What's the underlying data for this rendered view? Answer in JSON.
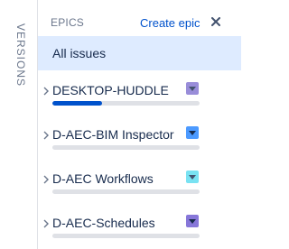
{
  "sidebar": {
    "versions_label": "VERSIONS"
  },
  "epics_panel": {
    "title": "EPICS",
    "create_label": "Create epic",
    "close_icon": "close-icon",
    "all_issues_label": "All issues",
    "items": [
      {
        "name": "DESKTOP-HUDDLE",
        "color": "#998dd9",
        "progress": 0.34
      },
      {
        "name": "D-AEC-BIM Inspector",
        "color": "#4c9aff",
        "progress": 0
      },
      {
        "name": "D-AEC Workflows",
        "color": "#79e2f2",
        "progress": 0
      },
      {
        "name": "D-AEC-Schedules",
        "color": "#8777d9",
        "progress": 0
      }
    ]
  }
}
